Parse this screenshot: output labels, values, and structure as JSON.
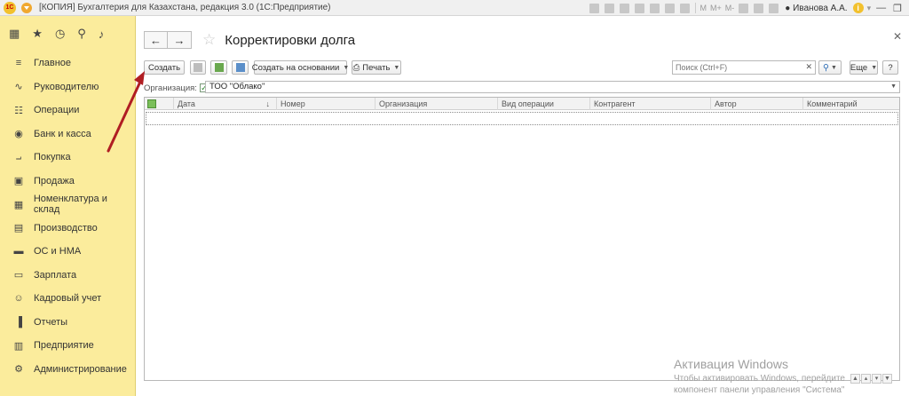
{
  "titlebar": {
    "logo": "1С",
    "title": "[КОПИЯ] Бухгалтерия для Казахстана, редакция 3.0  (1С:Предприятие)",
    "m_labels": [
      "M",
      "M+",
      "M-"
    ],
    "user": "Иванова А.А."
  },
  "sidebar": {
    "items": [
      {
        "label": "Главное",
        "icon": "menu-lines-icon"
      },
      {
        "label": "Руководителю",
        "icon": "chart-line-icon"
      },
      {
        "label": "Операции",
        "icon": "operations-icon"
      },
      {
        "label": "Банк и касса",
        "icon": "bank-icon"
      },
      {
        "label": "Покупка",
        "icon": "cart-icon"
      },
      {
        "label": "Продажа",
        "icon": "bag-icon"
      },
      {
        "label": "Номенклатура и склад",
        "icon": "warehouse-icon"
      },
      {
        "label": "Производство",
        "icon": "factory-icon"
      },
      {
        "label": "ОС и НМА",
        "icon": "truck-icon"
      },
      {
        "label": "Зарплата",
        "icon": "wallet-icon"
      },
      {
        "label": "Кадровый учет",
        "icon": "people-icon"
      },
      {
        "label": "Отчеты",
        "icon": "bar-chart-icon"
      },
      {
        "label": "Предприятие",
        "icon": "building-icon"
      },
      {
        "label": "Администрирование",
        "icon": "gear-icon"
      }
    ]
  },
  "form": {
    "title": "Корректировки долга",
    "toolbar": {
      "create": "Создать",
      "create_based": "Создать на основании",
      "print": "Печать",
      "search_placeholder": "Поиск (Ctrl+F)",
      "more": "Еще",
      "help": "?"
    },
    "org": {
      "label": "Организация:",
      "value": "ТОО \"Облако\""
    },
    "columns": [
      "Дата",
      "Номер",
      "Организация",
      "Вид операции",
      "Контрагент",
      "Автор",
      "Комментарий"
    ]
  },
  "watermark": {
    "line1": "Активация Windows",
    "line2": "Чтобы активировать Windows, перейдите",
    "line3": "компонент панели управления \"Система\""
  },
  "colors": {
    "sidebar_bg": "#fbec9c",
    "arrow": "#b01e23"
  }
}
